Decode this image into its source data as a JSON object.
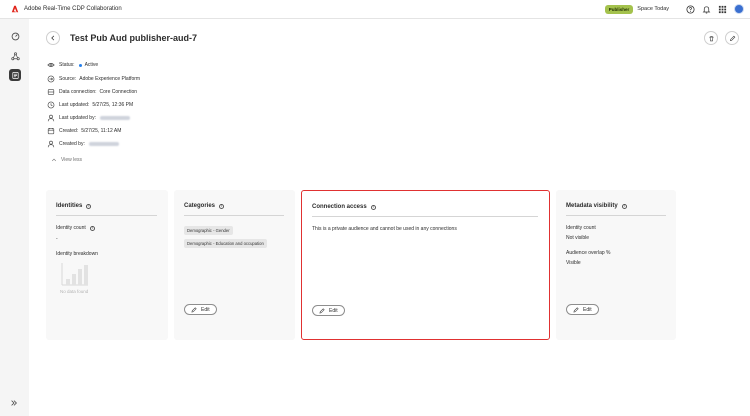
{
  "app": {
    "title": "Adobe Real-Time CDP Collaboration"
  },
  "topbar": {
    "badge": "Publisher",
    "space": "Space Today"
  },
  "page": {
    "title": "Test Pub Aud publisher-aud-7"
  },
  "meta": [
    {
      "label": "Status:",
      "value": "Active",
      "icon": "visibility-icon"
    },
    {
      "label": "Source:",
      "value": "Adobe Experience Platform",
      "icon": "source-icon"
    },
    {
      "label": "Data connection:",
      "value": "Core Connection",
      "icon": "database-icon"
    },
    {
      "label": "Last updated:",
      "value": "5/27/25, 12:36 PM",
      "icon": "clock-icon"
    },
    {
      "label": "Last updated by:",
      "value": "",
      "icon": "user-icon"
    },
    {
      "label": "Created:",
      "value": "5/27/25, 11:12 AM",
      "icon": "calendar-icon"
    },
    {
      "label": "Created by:",
      "value": "",
      "icon": "user-icon"
    }
  ],
  "view_less": "View less",
  "cards": {
    "identities": {
      "title": "Identities",
      "count_label": "Identity count",
      "count_value": "-",
      "breakdown_label": "Identity breakdown",
      "empty_label": "No data found"
    },
    "categories": {
      "title": "Categories",
      "tags": [
        "Demographic - Gender",
        "Demographic - Education and occupation"
      ],
      "edit": "Edit"
    },
    "connection": {
      "title": "Connection access",
      "text": "This is a private audience and cannot be used in any connections",
      "edit": "Edit"
    },
    "metadata": {
      "title": "Metadata visibility",
      "identity_count_label": "Identity count",
      "identity_count_value": "Not visible",
      "overlap_label": "Audience overlap %",
      "overlap_value": "Visible",
      "edit": "Edit"
    }
  },
  "colors": {
    "accent": "#2680eb",
    "publisher_badge": "#a4c24d",
    "selected_border": "#e03131"
  }
}
